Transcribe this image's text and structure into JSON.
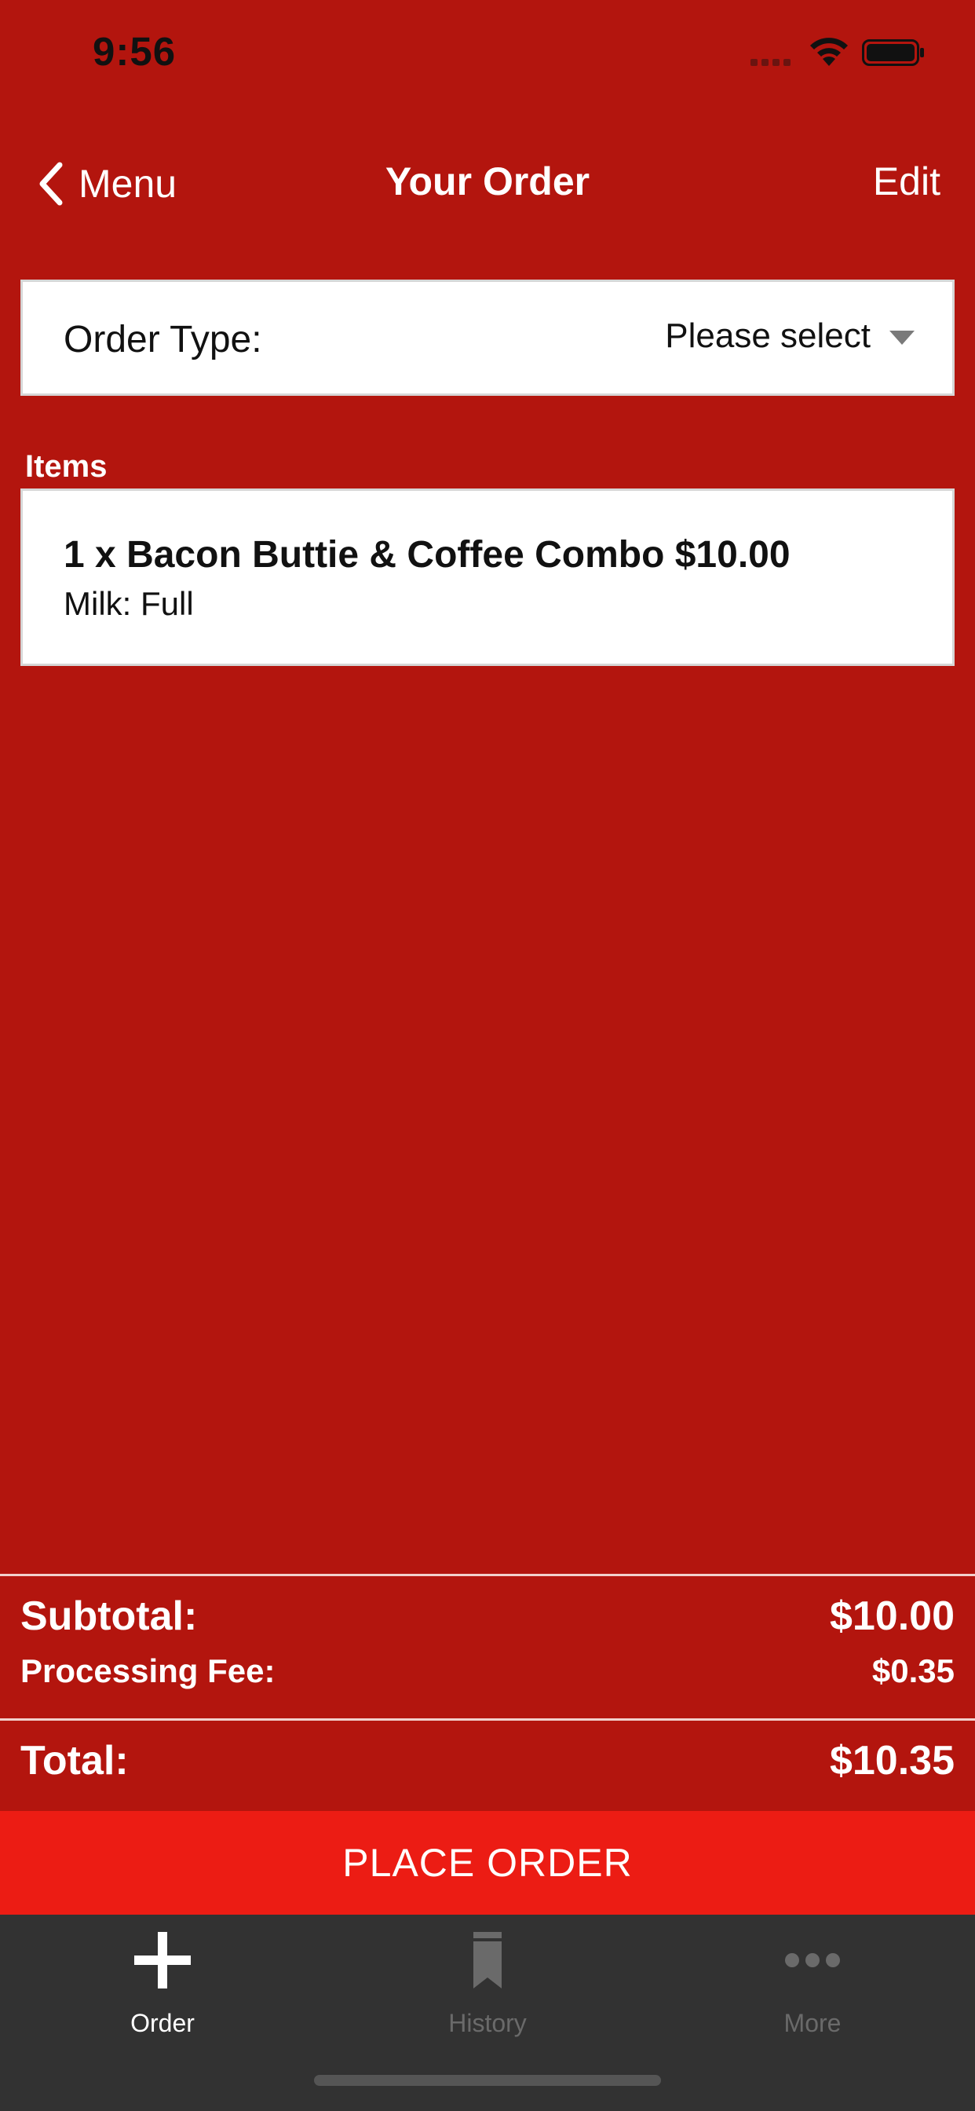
{
  "status_bar": {
    "time": "9:56",
    "icons": [
      "cellular-signal-icon",
      "wifi-icon",
      "battery-icon"
    ]
  },
  "nav": {
    "back_label": "Menu",
    "title": "Your Order",
    "edit_label": "Edit"
  },
  "order_type": {
    "label": "Order Type:",
    "value": "Please select"
  },
  "items": {
    "section_label": "Items",
    "list": [
      {
        "title": "1 x Bacon Buttie & Coffee Combo $10.00",
        "modifier": "Milk: Full"
      }
    ]
  },
  "totals": {
    "subtotal_label": "Subtotal:",
    "subtotal_value": "$10.00",
    "fee_label": "Processing Fee:",
    "fee_value": "$0.35",
    "total_label": "Total:",
    "total_value": "$10.35"
  },
  "actions": {
    "place_order_label": "PLACE ORDER"
  },
  "tabbar": {
    "tabs": [
      {
        "label": "Order",
        "icon": "plus-icon",
        "active": true
      },
      {
        "label": "History",
        "icon": "bookmark-icon",
        "active": false
      },
      {
        "label": "More",
        "icon": "more-dots-icon",
        "active": false
      }
    ]
  },
  "colors": {
    "background": "#b3150e",
    "place_order_button": "#ec1c14",
    "tabbar_background": "#323232",
    "tab_active": "#ffffff",
    "tab_inactive": "#6a6a6a"
  }
}
